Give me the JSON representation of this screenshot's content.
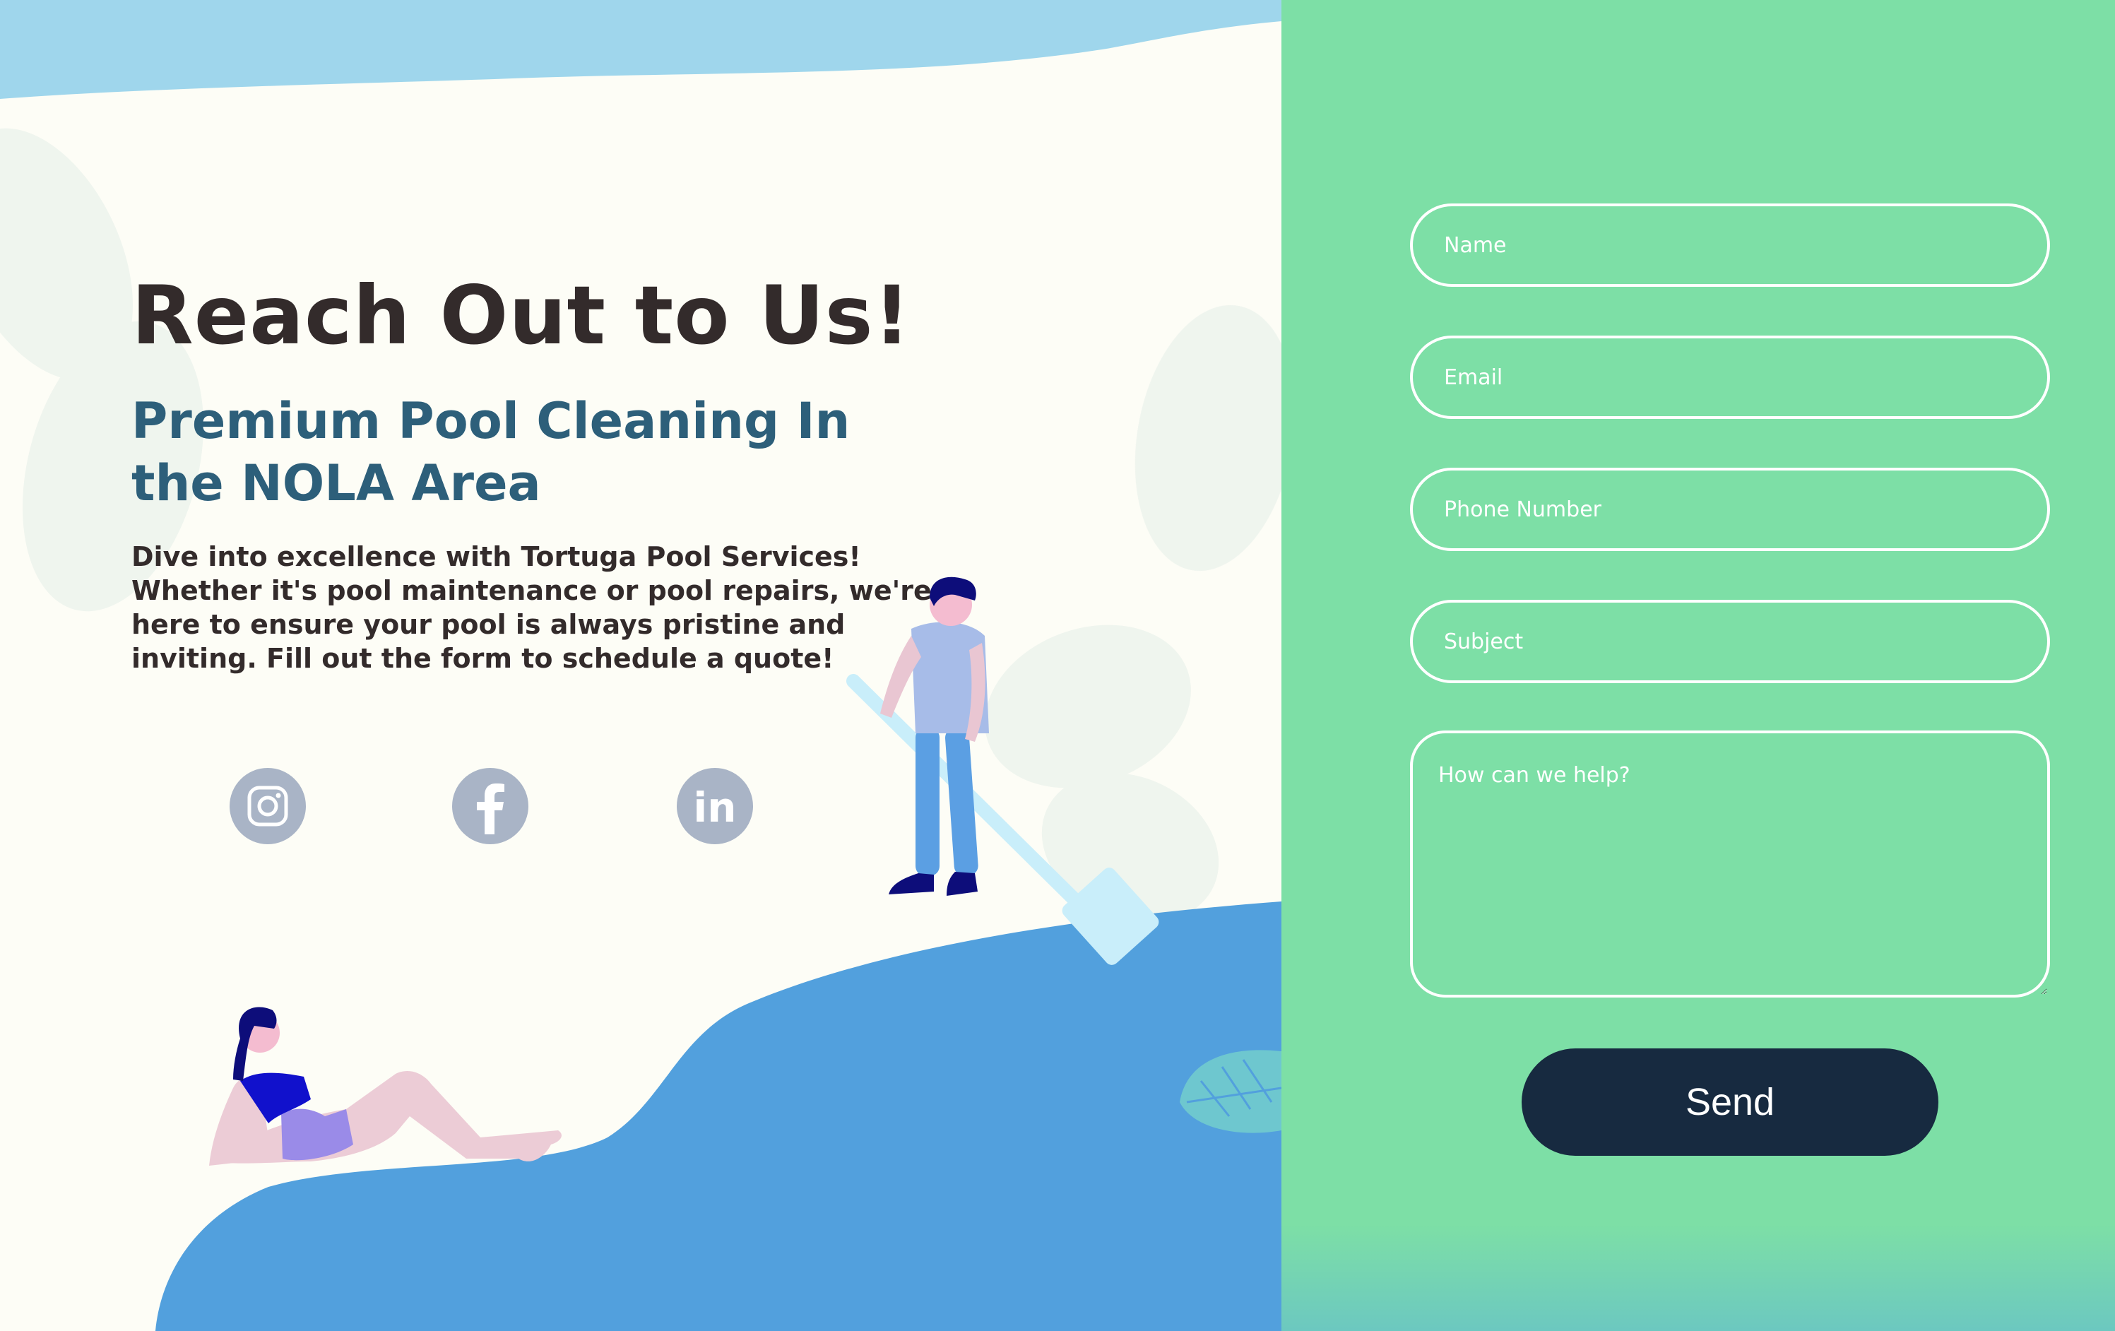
{
  "hero": {
    "title": "Reach Out to Us!",
    "subtitle": "Premium Pool Cleaning In the NOLA Area",
    "description": "Dive into excellence with Tortuga Pool Services! Whether it's pool maintenance or pool repairs, we're here to ensure your pool is always pristine and inviting. Fill out the form to schedule a quote!"
  },
  "social": [
    {
      "name": "instagram",
      "icon": "instagram-icon"
    },
    {
      "name": "facebook",
      "icon": "facebook-icon"
    },
    {
      "name": "linkedin",
      "icon": "linkedin-icon",
      "glyph": "in"
    }
  ],
  "form": {
    "name_placeholder": "Name",
    "email_placeholder": "Email",
    "phone_placeholder": "Phone Number",
    "subject_placeholder": "Subject",
    "message_placeholder": "How can we help?",
    "send_label": "Send"
  },
  "colors": {
    "page_background": "#fdfdf6",
    "form_panel": "#7ddfa6",
    "pool": "#52a0dd",
    "sky_wave": "#9fd6ec",
    "title": "#332b2b",
    "subtitle": "#2d5f7a",
    "social_icon": "#a9b4c6",
    "send_button": "#172a40"
  }
}
